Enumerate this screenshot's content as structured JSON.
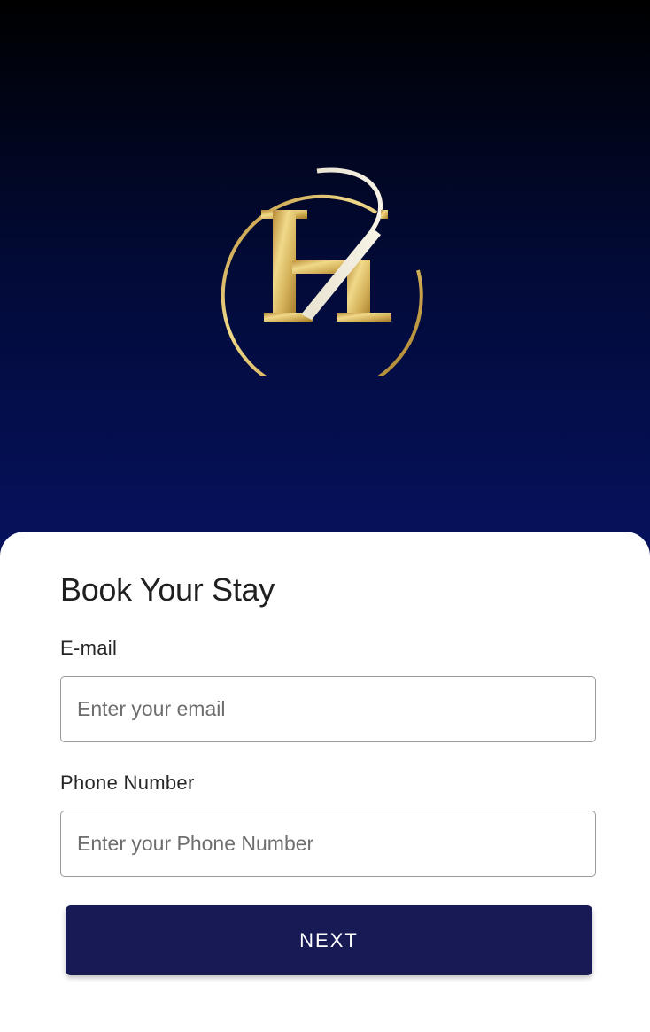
{
  "brand": {
    "logo_icon": "hotel-monogram-logo",
    "colors": {
      "hero_top": "#000000",
      "hero_bottom": "#061260",
      "gold": "#d4b25a",
      "button": "#171a55"
    }
  },
  "form": {
    "title": "Book Your Stay",
    "email": {
      "label": "E-mail",
      "placeholder": "Enter your email",
      "value": ""
    },
    "phone": {
      "label": "Phone Number",
      "placeholder": "Enter your Phone Number",
      "value": ""
    },
    "next_label": "NEXT"
  }
}
